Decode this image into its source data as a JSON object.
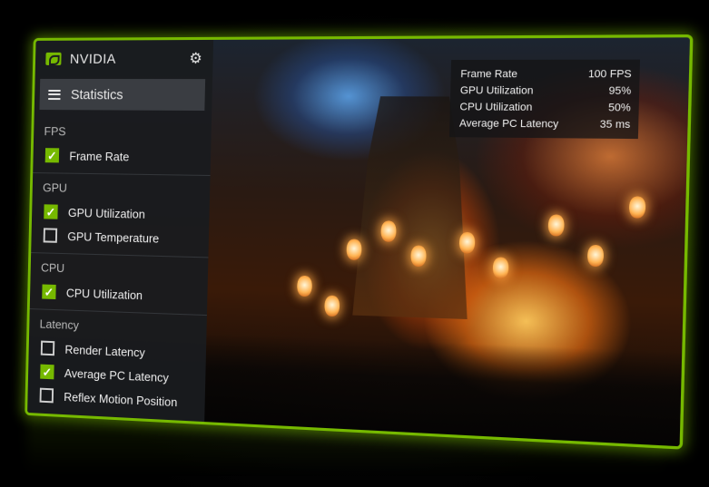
{
  "sidebar": {
    "brand": "NVIDIA",
    "title": "Statistics",
    "groups": [
      {
        "label": "FPS",
        "items": [
          {
            "label": "Frame Rate",
            "checked": true
          }
        ]
      },
      {
        "label": "GPU",
        "items": [
          {
            "label": "GPU Utilization",
            "checked": true
          },
          {
            "label": "GPU Temperature",
            "checked": false
          }
        ]
      },
      {
        "label": "CPU",
        "items": [
          {
            "label": "CPU Utilization",
            "checked": true
          }
        ]
      },
      {
        "label": "Latency",
        "items": [
          {
            "label": "Render Latency",
            "checked": false
          },
          {
            "label": "Average PC Latency",
            "checked": true
          },
          {
            "label": "Reflex Motion Position",
            "checked": false
          }
        ]
      }
    ]
  },
  "stats": [
    {
      "label": "Frame Rate",
      "value": "100 FPS"
    },
    {
      "label": "GPU Utilization",
      "value": "95%"
    },
    {
      "label": "CPU Utilization",
      "value": "50%"
    },
    {
      "label": "Average PC Latency",
      "value": "35 ms"
    }
  ],
  "colors": {
    "accent": "#76b900",
    "panel": "#1a1c1f"
  },
  "icons": {
    "logo": "nvidia-logo-icon",
    "settings": "gear-icon",
    "menu": "hamburger-menu-icon",
    "check": "check-icon"
  }
}
